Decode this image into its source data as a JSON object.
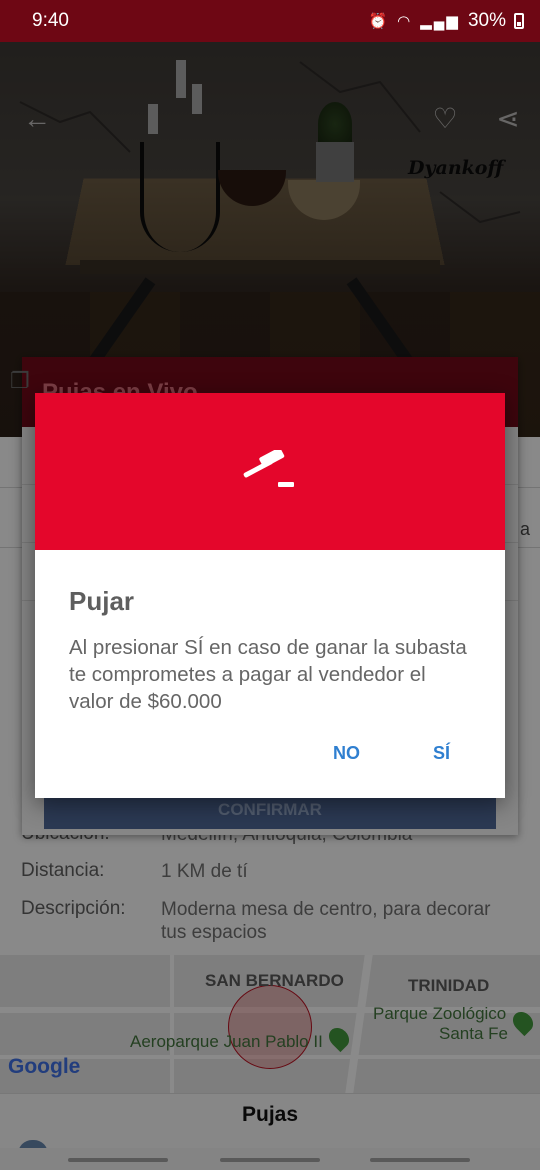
{
  "status_bar": {
    "time": "9:40",
    "battery": "30%"
  },
  "hero": {
    "signature": "Dyankoff"
  },
  "sheet": {
    "title": "Pujas en Vivo",
    "confirm_label": "CONFIRMAR",
    "side_letter": "a"
  },
  "details": [
    {
      "label": "Ubicación:",
      "value": "Medellín, Antioquia, Colombia"
    },
    {
      "label": "Distancia:",
      "value": "1 KM de tí"
    },
    {
      "label": "Descripción:",
      "value": "Moderna mesa de centro, para decorar tus espacios"
    }
  ],
  "map": {
    "labels": [
      "SAN BERNARDO",
      "TRINIDAD",
      "Parque Zoológico",
      "Santa Fe",
      "Aeroparque Juan Pablo II"
    ],
    "attribution": "Google"
  },
  "bottom_title": "Pujas",
  "dialog": {
    "icon": "gavel-icon",
    "title": "Pujar",
    "message": "Al presionar SÍ en caso de ganar la subasta te comprometes a pagar al vendedor el valor de $60.000",
    "no_label": "NO",
    "yes_label": "SÍ"
  },
  "colors": {
    "accent": "#e4062b",
    "status": "#6e0714",
    "button_text": "#2f7fd0"
  }
}
